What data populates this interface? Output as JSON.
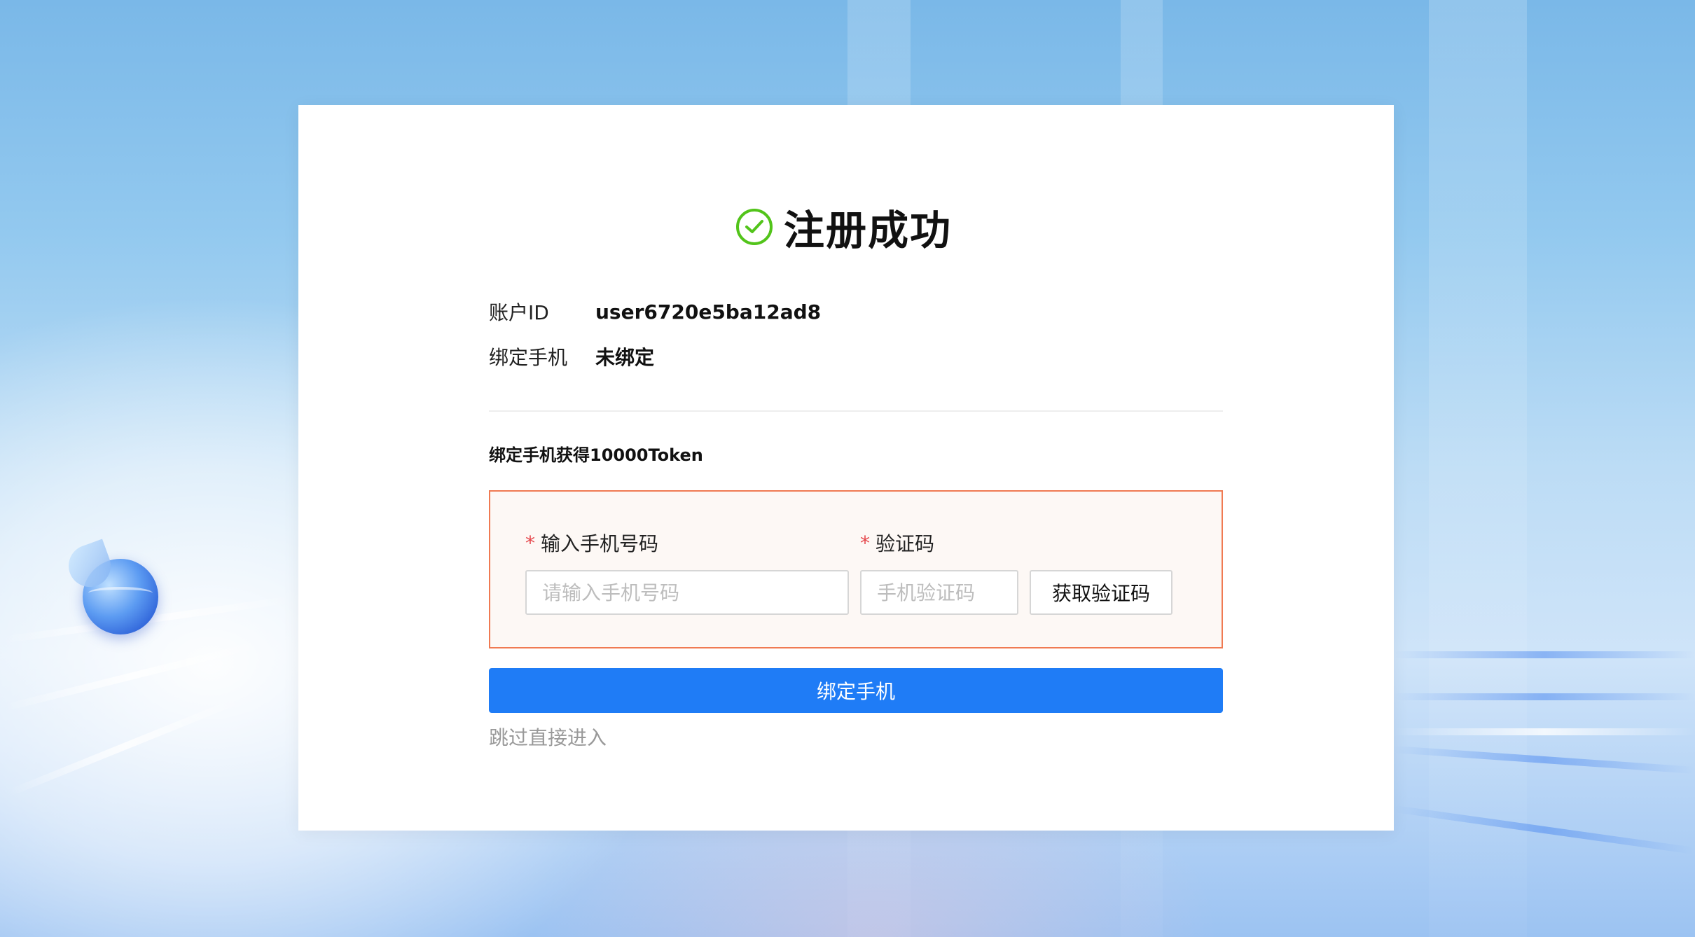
{
  "title": "注册成功",
  "colors": {
    "success": "#52c41a",
    "primary": "#1f7cf6",
    "required": "#e5484d",
    "highlight_border": "#f07a52"
  },
  "icons": {
    "title_icon": "check-circle-icon"
  },
  "account": {
    "id_label": "账户ID",
    "id_value": "user6720e5ba12ad8",
    "phone_label": "绑定手机",
    "phone_value": "未绑定"
  },
  "promo_text": "绑定手机获得10000Token",
  "form": {
    "required_mark": "*",
    "phone_label": "输入手机号码",
    "phone_placeholder": "请输入手机号码",
    "phone_value": "",
    "code_label": "验证码",
    "code_placeholder": "手机验证码",
    "code_value": "",
    "get_code_button": "获取验证码"
  },
  "submit_button": "绑定手机",
  "skip_link": "跳过直接进入"
}
